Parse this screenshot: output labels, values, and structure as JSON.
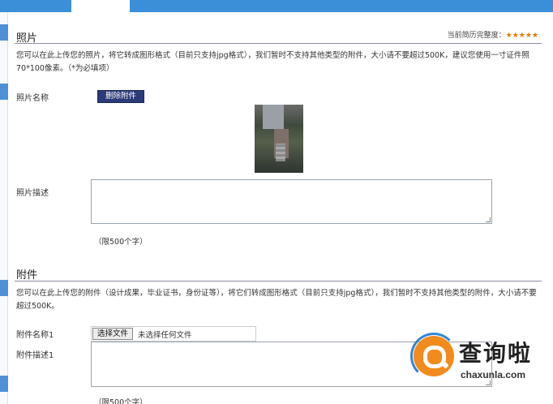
{
  "photo_section": {
    "title": "照片",
    "progress_label": "当前简历完整度：",
    "progress_stars": "★★★★★",
    "progress_rating": 5,
    "description": "您可以在此上传您的照片，将它转成图形格式（目前只支持jpg格式），我们暂时不支持其他类型的附件，大小请不要超过500K，建议您使用一寸证件照70*100像素。（*为必填项）",
    "name_label": "照片名称",
    "delete_button": "删除附件",
    "desc_label": "照片描述",
    "char_limit": "（限500个字）"
  },
  "attachment_section": {
    "title": "附件",
    "description": "您可以在此上传您的附件（设计成果，毕业证书，身份证等），将它们转成图形格式（目前只支持jpg格式），我们暂时不支持其他类型的附件，大小请不要超过500K。",
    "name_label": "附件名称1",
    "choose_file_button": "选择文件",
    "no_file_text": "未选择任何文件",
    "desc_label": "附件描述1",
    "char_limit": "（限500个字）"
  },
  "watermark": {
    "text": "查询啦",
    "url": "chaxunla.com"
  },
  "colors": {
    "topbar": "#3a8fd8",
    "button": "#2d3a78",
    "stars": "#e07a00",
    "watermark_orange": "#f28b1e",
    "watermark_blue": "#2f86d9"
  }
}
